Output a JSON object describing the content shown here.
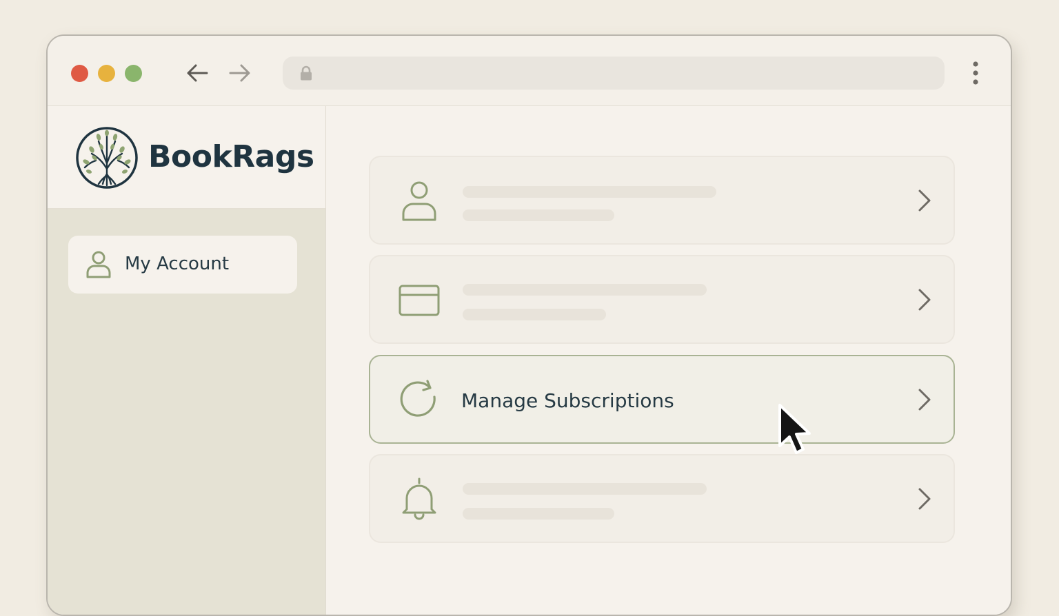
{
  "browser": {
    "window_controls": [
      {
        "name": "close",
        "color": "#df5a44"
      },
      {
        "name": "minimize",
        "color": "#e7b23e"
      },
      {
        "name": "zoom",
        "color": "#8ab56c"
      }
    ],
    "nav": {
      "back_icon": "arrow-left-icon",
      "forward_icon": "arrow-right-icon"
    },
    "address": {
      "url": "",
      "icon": "lock-icon"
    },
    "menu_icon": "kebab-menu-icon"
  },
  "brand": {
    "name": "BookRags",
    "logo_icon": "tree-logo-icon",
    "name_color": "#1f3440"
  },
  "sidebar": {
    "items": [
      {
        "label": "My Account",
        "icon": "user-icon",
        "selected": true
      }
    ]
  },
  "main": {
    "cards": [
      {
        "icon": "user-icon",
        "title": "",
        "placeholder": true,
        "chevron_icon": "chevron-right-icon"
      },
      {
        "icon": "credit-card-icon",
        "title": "",
        "placeholder": true,
        "chevron_icon": "chevron-right-icon"
      },
      {
        "icon": "refresh-icon",
        "title": "Manage Subscriptions",
        "placeholder": false,
        "highlighted": true,
        "chevron_icon": "chevron-right-icon"
      },
      {
        "icon": "bell-icon",
        "title": "",
        "placeholder": true,
        "chevron_icon": "chevron-right-icon"
      }
    ]
  },
  "colors": {
    "accent_green": "#8f9e75",
    "highlight_border": "#a9b394",
    "text_dark": "#263a44",
    "sidebar_bg": "#e5e2d4",
    "page_bg": "#f6f2ec"
  },
  "cursor": {
    "icon": "mouse-pointer-icon"
  }
}
